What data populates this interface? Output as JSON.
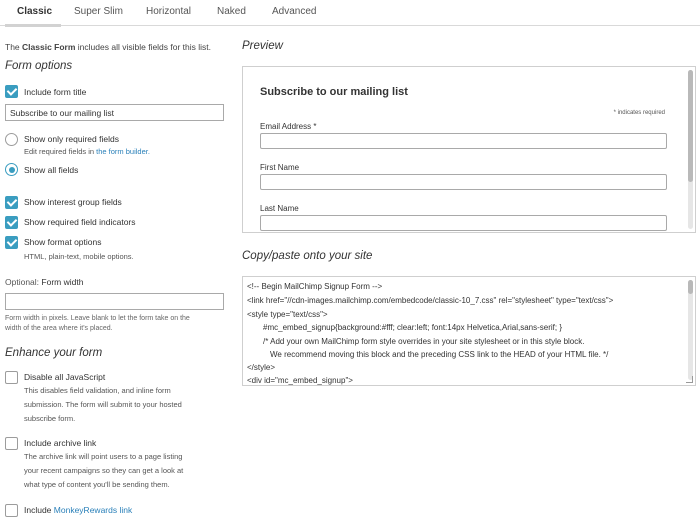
{
  "tabs": [
    {
      "label": "Classic",
      "active": true
    },
    {
      "label": "Super Slim",
      "active": false
    },
    {
      "label": "Horizontal",
      "active": false
    },
    {
      "label": "Naked",
      "active": false
    },
    {
      "label": "Advanced",
      "active": false
    }
  ],
  "intro": {
    "prefix": "The",
    "form_name": "Classic Form",
    "suffix": "includes all visible fields for this list."
  },
  "form_options": {
    "heading": "Form options",
    "include_title": {
      "label": "Include form title",
      "checked": true
    },
    "title_value": "Subscribe to our mailing list",
    "show_required": {
      "label": "Show only required fields",
      "selected": false,
      "help_prefix": "Edit required fields in",
      "help_link": "the form builder."
    },
    "show_all": {
      "label": "Show all fields",
      "selected": true
    },
    "interest_groups": {
      "label": "Show interest group fields",
      "checked": true
    },
    "required_indicators": {
      "label": "Show required field indicators",
      "checked": true
    },
    "format_options": {
      "label": "Show format options",
      "checked": true,
      "help": "HTML, plain-text, mobile options."
    },
    "width": {
      "optional": "Optional:",
      "label": "Form width",
      "value": "",
      "help_lines": [
        "Form width in pixels. Leave blank to let the form take on the",
        "width of the area where it's placed."
      ]
    }
  },
  "enhance": {
    "heading": "Enhance your form",
    "disable_js": {
      "label": "Disable all JavaScript",
      "checked": false,
      "desc": [
        "This disables field validation, and inline form",
        "submission. The form will submit to your hosted",
        "subscribe form."
      ]
    },
    "archive": {
      "label": "Include archive link",
      "checked": false,
      "desc": [
        "The archive link will point users to a page listing",
        "your recent campaigns so they can get a look at",
        "what type of content you'll be sending them."
      ]
    },
    "monkey": {
      "prefix": "Include",
      "link": "MonkeyRewards link",
      "checked": false
    }
  },
  "preview": {
    "heading": "Preview",
    "title": "Subscribe to our mailing list",
    "req_note": "* indicates required",
    "fields": [
      "Email Address *",
      "First Name",
      "Last Name"
    ]
  },
  "copy": {
    "heading": "Copy/paste onto your site",
    "lines": [
      "<!-- Begin MailChimp Signup Form -->",
      "<link href=\"//cdn-images.mailchimp.com/embedcode/classic-10_7.css\" rel=\"stylesheet\" type=\"text/css\">",
      "<style type=\"text/css\">",
      "#mc_embed_signup{background:#fff; clear:left; font:14px Helvetica,Arial,sans-serif; }",
      "/* Add your own MailChimp form style overrides in your site stylesheet or in this style block.",
      "We recommend moving this block and the preceding CSS link to the HEAD of your HTML file. */",
      "</style>",
      "<div id=\"mc_embed_signup\">"
    ]
  },
  "colors": {
    "accent": "#3a9dc0",
    "link": "#2a80b9"
  }
}
